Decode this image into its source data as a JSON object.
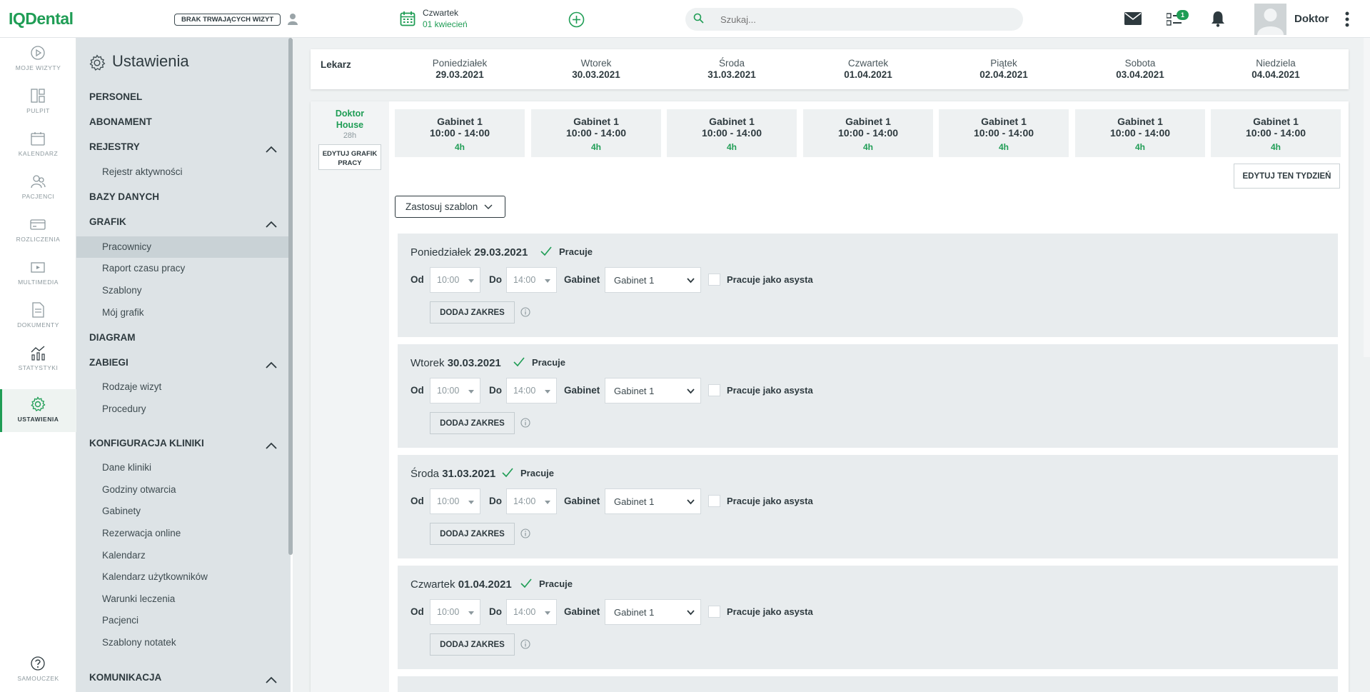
{
  "header": {
    "logo": "IQDental",
    "no_visit": "BRAK TRWAJĄCYCH WIZYT",
    "day_name": "Czwartek",
    "day_date": "01 kwiecień",
    "search_placeholder": "Szukaj...",
    "tasks_badge": "1",
    "user_name": "Doktor"
  },
  "rail": [
    {
      "label": "MOJE WIZYTY",
      "icon": "play-circle-icon"
    },
    {
      "label": "PULPIT",
      "icon": "dashboard-icon"
    },
    {
      "label": "KALENDARZ",
      "icon": "calendar-icon"
    },
    {
      "label": "PACJENCI",
      "icon": "patients-icon"
    },
    {
      "label": "ROZLICZENIA",
      "icon": "card-icon"
    },
    {
      "label": "MULTIMEDIA",
      "icon": "media-icon"
    },
    {
      "label": "DOKUMENTY",
      "icon": "document-icon"
    },
    {
      "label": "STATYSTYKI",
      "icon": "stats-icon"
    },
    {
      "label": "USTAWIENIA",
      "icon": "gear-icon"
    }
  ],
  "rail_bottom": {
    "label": "SAMOUCZEK",
    "icon": "help-icon"
  },
  "sidebar": {
    "title": "Ustawienia",
    "sections": [
      "PERSONEL",
      "ABONAMENT",
      "REJESTRY",
      "BAZY DANYCH",
      "GRAFIK",
      "DIAGRAM",
      "ZABIEGI",
      "KONFIGURACJA KLINIKI",
      "KOMUNIKACJA"
    ],
    "rejestry_items": [
      "Rejestr aktywności"
    ],
    "grafik_items": [
      "Pracownicy",
      "Raport czasu pracy",
      "Szablony",
      "Mój grafik"
    ],
    "zabiegi_items": [
      "Rodzaje wizyt",
      "Procedury"
    ],
    "konfig_items": [
      "Dane kliniki",
      "Godziny otwarcia",
      "Gabinety",
      "Rezerwacja online",
      "Kalendarz",
      "Kalendarz użytkowników",
      "Warunki leczenia",
      "Pacjenci",
      "Szablony notatek"
    ]
  },
  "schedule": {
    "lekarz_label": "Lekarz",
    "days": [
      {
        "name": "Poniedziałek",
        "date": "29.03.2021"
      },
      {
        "name": "Wtorek",
        "date": "30.03.2021"
      },
      {
        "name": "Środa",
        "date": "31.03.2021"
      },
      {
        "name": "Czwartek",
        "date": "01.04.2021"
      },
      {
        "name": "Piątek",
        "date": "02.04.2021"
      },
      {
        "name": "Sobota",
        "date": "03.04.2021"
      },
      {
        "name": "Niedziela",
        "date": "04.04.2021"
      }
    ],
    "doctor_first": "Doktor",
    "doctor_last": "House",
    "doctor_hours": "28h",
    "edit_grafik_l1": "EDYTUJ GRAFIK",
    "edit_grafik_l2": "PRACY",
    "shift_room": "Gabinet 1",
    "shift_time": "10:00 - 14:00",
    "shift_hours": "4h",
    "edit_week": "EDYTUJ TEN TYDZIEŃ",
    "apply_template": "Zastosuj szablon"
  },
  "day_form": {
    "od": "Od",
    "do": "Do",
    "gabinet": "Gabinet",
    "pracuje": "Pracuje",
    "from_value": "10:00",
    "to_value": "14:00",
    "room_value": "Gabinet 1",
    "assistant": "Pracuje jako asysta",
    "add_range": "DODAJ ZAKRES",
    "panels": [
      {
        "name": "Poniedziałek",
        "date": "29.03.2021"
      },
      {
        "name": "Wtorek",
        "date": "30.03.2021"
      },
      {
        "name": "Środa",
        "date": "31.03.2021"
      },
      {
        "name": "Czwartek",
        "date": "01.04.2021"
      }
    ]
  }
}
